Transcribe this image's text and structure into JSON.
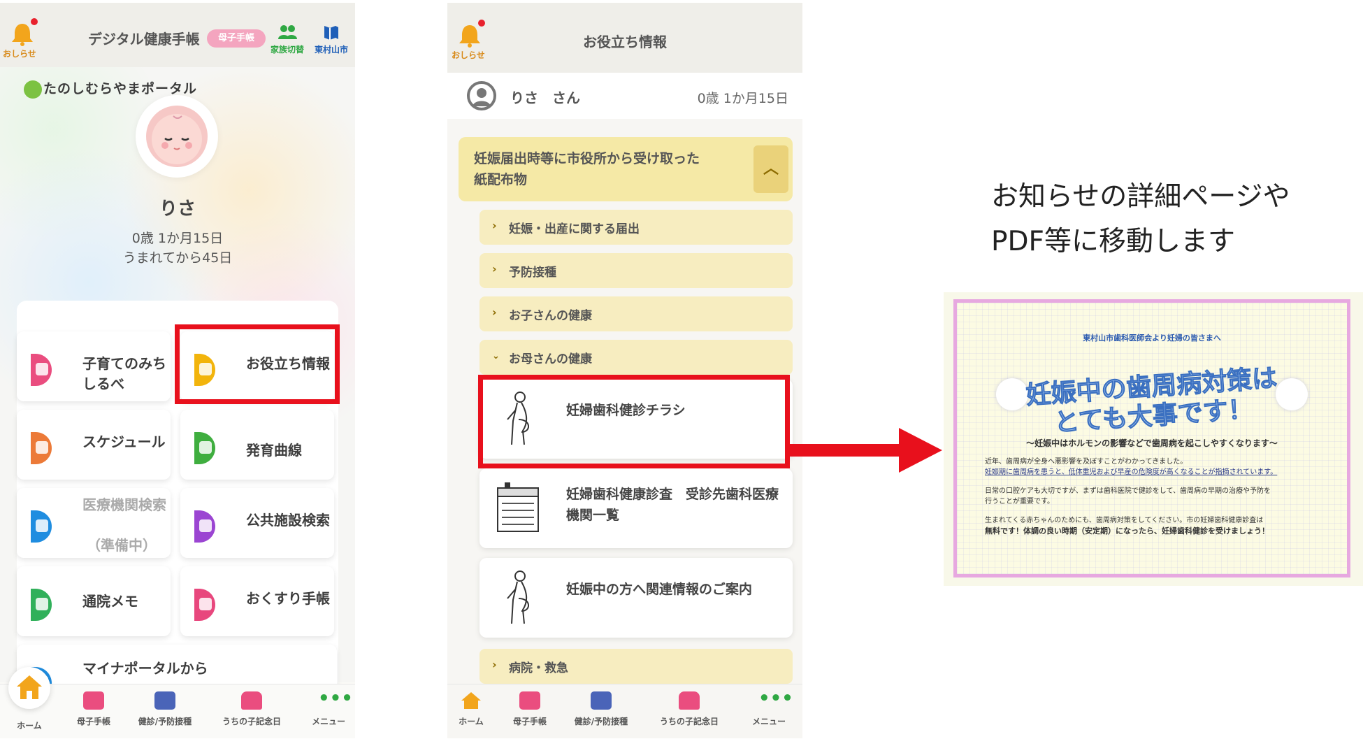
{
  "phone1": {
    "bell_label": "おしらせ",
    "title": "デジタル健康手帳",
    "title_pill": "母子手帳",
    "family_switch_label": "家族切替",
    "city_label": "東村山市",
    "portal_logo": "たのしむらやまポータル",
    "child": {
      "name": "りさ",
      "age": "0歳 1か月15日",
      "days_since_birth": "うまれてから45日"
    },
    "tiles": [
      {
        "label": "子育てのみちしるべ",
        "color": "#ea4d7f"
      },
      {
        "label": "お役立ち情報",
        "color": "#f2b40c"
      },
      {
        "label": "スケジュール",
        "color": "#ec7a38"
      },
      {
        "label": "発育曲線",
        "color": "#3fae3f"
      },
      {
        "label": "医療機関検索",
        "sublabel": "（準備中）",
        "color": "#1f8de0"
      },
      {
        "label": "公共施設検索",
        "color": "#9b45d2"
      },
      {
        "label": "通院メモ",
        "color": "#30b05a"
      },
      {
        "label": "おくすり手帳",
        "color": "#e8477d"
      },
      {
        "label": "マイナポータルから",
        "color": "#1f8de0"
      }
    ],
    "tabs": [
      {
        "label": "ホーム",
        "color": "#f2a51c"
      },
      {
        "label": "母子手帳",
        "color": "#ea4d7f"
      },
      {
        "label": "健診/予防接種",
        "color": "#4a64b8"
      },
      {
        "label": "うちの子記念日",
        "color": "#ea4d7f"
      },
      {
        "label": "メニュー",
        "color": "#2fa843"
      }
    ]
  },
  "phone2": {
    "bell_label": "おしらせ",
    "title": "お役立ち情報",
    "user_name": "りさ　さん",
    "user_age": "0歳 1か月15日",
    "accordion_title": "妊娠届出時等に市役所から受け取った紙配布物",
    "subsections": [
      {
        "label": "妊娠・出産に関する届出",
        "state": "collapsed"
      },
      {
        "label": "予防接種",
        "state": "collapsed"
      },
      {
        "label": "お子さんの健康",
        "state": "collapsed"
      },
      {
        "label": "お母さんの健康",
        "state": "expanded"
      }
    ],
    "documents": [
      {
        "label": "妊婦歯科健診チラシ"
      },
      {
        "label": "妊婦歯科健康診査　受診先歯科医療機関一覧"
      },
      {
        "label": "妊娠中の方へ関連情報のご案内"
      }
    ],
    "last_section": "病院・救急",
    "tabs": [
      {
        "label": "ホーム",
        "color": "#f2a51c"
      },
      {
        "label": "母子手帳",
        "color": "#ea4d7f"
      },
      {
        "label": "健診/予防接種",
        "color": "#4a64b8"
      },
      {
        "label": "うちの子記念日",
        "color": "#ea4d7f"
      },
      {
        "label": "メニュー",
        "color": "#2fa843"
      }
    ]
  },
  "caption": {
    "line1": "お知らせの詳細ページや",
    "line2": "PDF等に移動します"
  },
  "flyer": {
    "top_line": "東村山市歯科医師会より妊婦の皆さまへ",
    "headline": "妊娠中の歯周病対策はとても大事です！",
    "sub": "～妊娠中はホルモンの影響などで歯周病を起こしやすくなります～",
    "p1_line1": "近年、歯周病が全身へ悪影響を及ぼすことがわかってきました。",
    "p1_line2": "妊娠期に歯周病を患うと、低体重児および早産の危険度が高くなることが指摘されています。",
    "p2_line1": "日常の口腔ケアも大切ですが、まずは歯科医院で健診をして、歯周病の早期の治療や予防を",
    "p2_line2": "行うことが重要です。",
    "p3_line1": "生まれてくる赤ちゃんのためにも、歯周病対策をしてください。市の妊婦歯科健康診査は",
    "p3_line2": "無料です！体調の良い時期（安定期）になったら、妊婦歯科健診を受けましょう！"
  },
  "colors": {
    "highlight": "#e8101c",
    "accordion": "#f5e9a6",
    "bell": "#f2a51c"
  }
}
